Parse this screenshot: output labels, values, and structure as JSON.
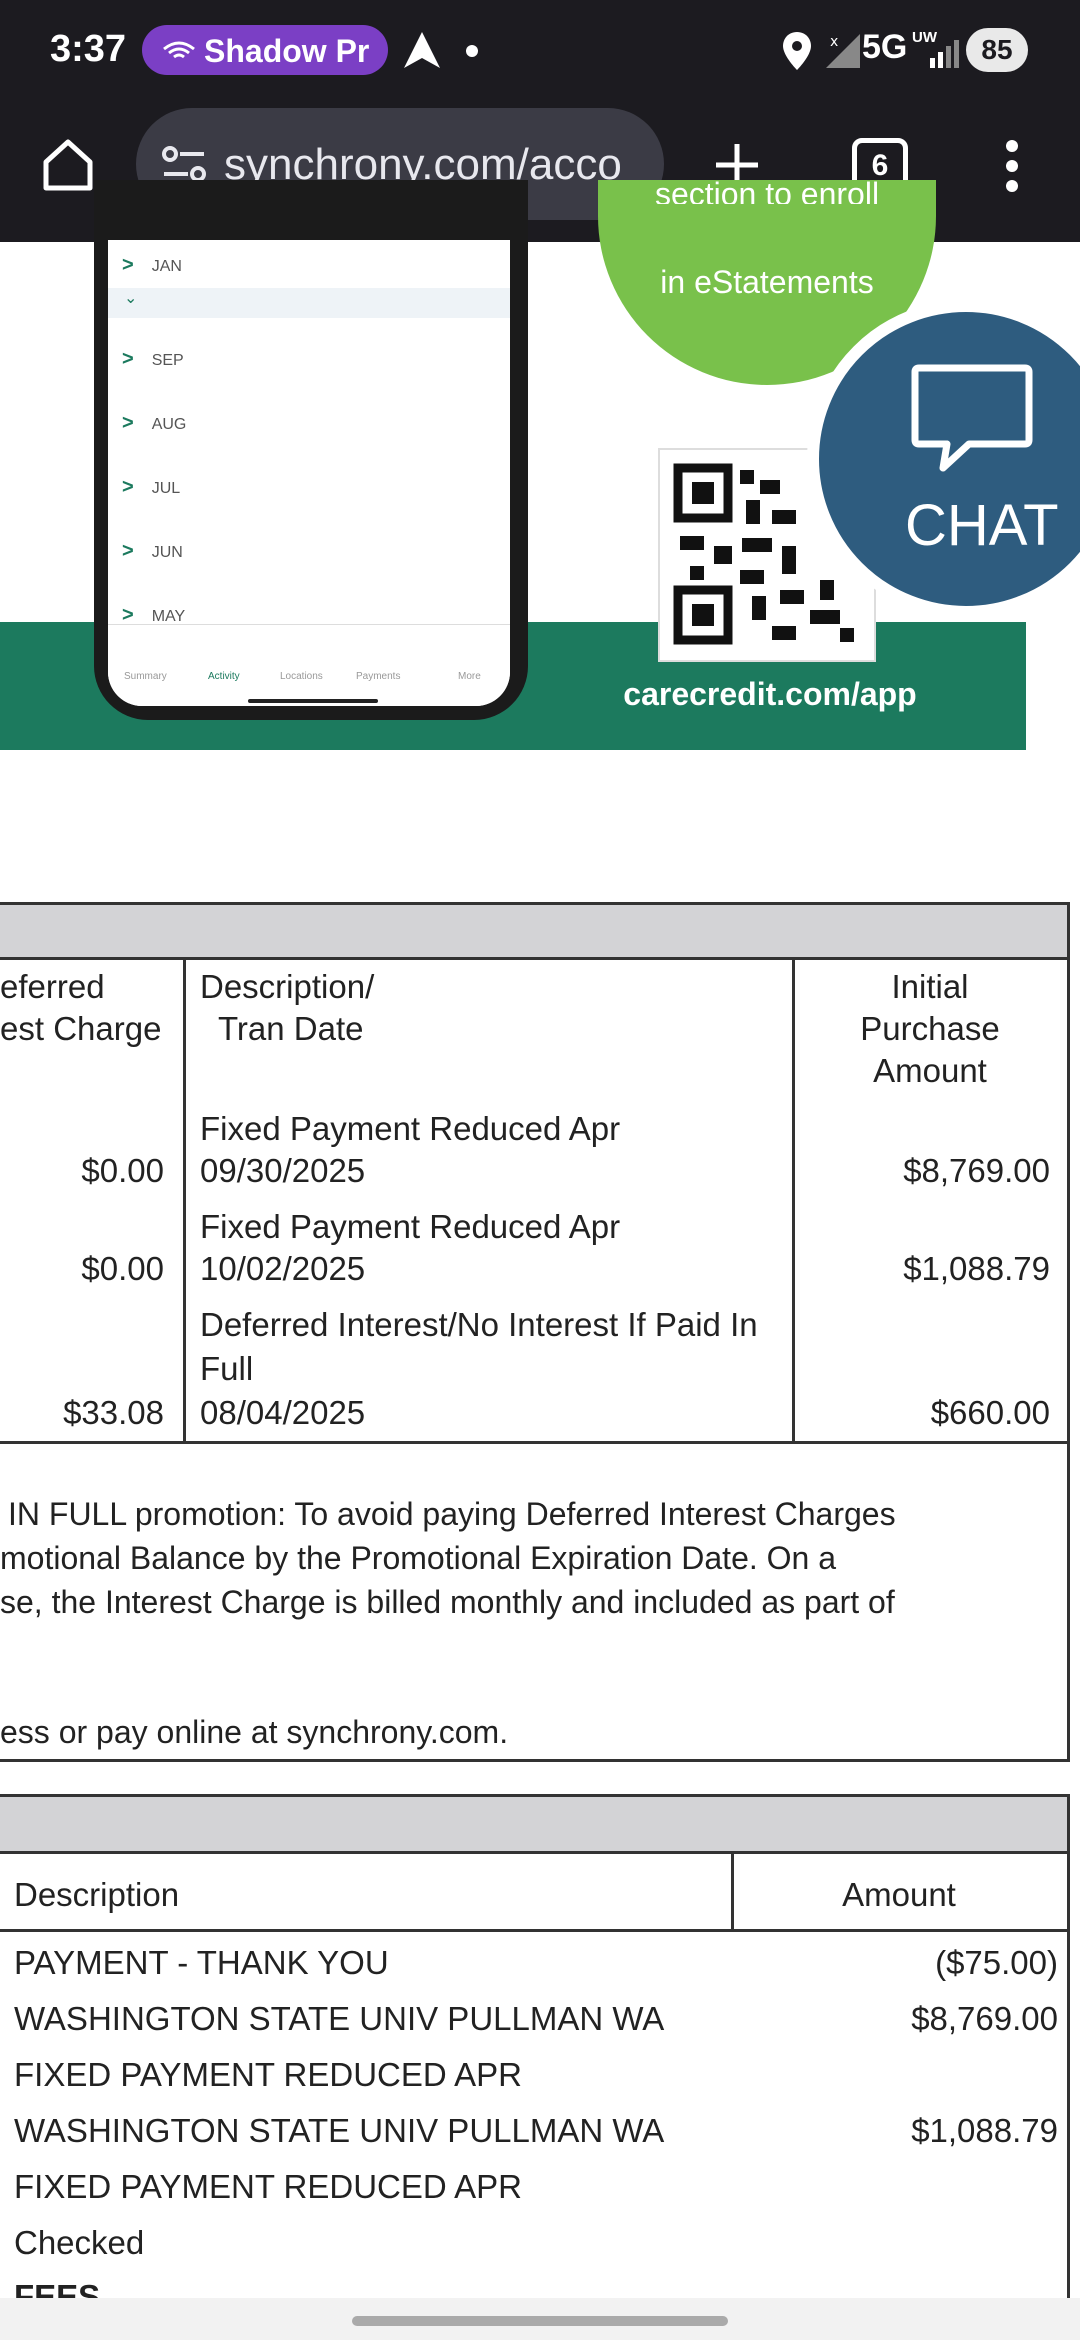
{
  "status_bar": {
    "time": "3:37",
    "notification_app": "Shadow Pr",
    "network": "5G",
    "network_sup": "UW",
    "battery": "85"
  },
  "browser": {
    "url": "synchrony.com/acco",
    "tab_count": "6"
  },
  "ad": {
    "circle_line1": "section to enroll",
    "circle_line2": "in eStatements",
    "app_url": "carecredit.com/app",
    "months": [
      "JAN",
      "SEP",
      "AUG",
      "JUL",
      "JUN",
      "MAY"
    ],
    "nav_items": [
      "Summary",
      "Activity",
      "Locations",
      "Payments",
      "More"
    ]
  },
  "chat": {
    "label": "CHAT"
  },
  "promo_table": {
    "headers": {
      "charge_line1": "eferred",
      "charge_line2": "est Charge",
      "desc_line1": "Description/",
      "desc_line2": "Tran Date",
      "amount_line1": "Initial",
      "amount_line2": "Purchase",
      "amount_line3": "Amount"
    },
    "rows": [
      {
        "charge": "$0.00",
        "desc1": "Fixed Payment Reduced Apr",
        "desc2": "09/30/2025",
        "amount": "$8,769.00"
      },
      {
        "charge": "$0.00",
        "desc1": "Fixed Payment Reduced Apr",
        "desc2": "10/02/2025",
        "amount": "$1,088.79"
      },
      {
        "charge": "$33.08",
        "desc1": "Deferred Interest/No Interest If Paid In",
        "desc1b": "Full",
        "desc2": "08/04/2025",
        "amount": "$660.00"
      }
    ],
    "note_line1": "IN FULL promotion: To avoid paying Deferred Interest Charges",
    "note_line2": "motional Balance by the Promotional Expiration Date.  On a",
    "note_line3": "se, the Interest Charge is billed monthly and included as part of",
    "note_line4": "ess or pay online at synchrony.com."
  },
  "transactions": {
    "headers": {
      "description": "Description",
      "amount": "Amount"
    },
    "rows": [
      {
        "description": "PAYMENT - THANK YOU",
        "amount": "($75.00)"
      },
      {
        "description": "WASHINGTON STATE UNIV PULLMAN  WA",
        "amount": "$8,769.00"
      },
      {
        "description": "FIXED PAYMENT REDUCED APR",
        "amount": ""
      },
      {
        "description": "WASHINGTON STATE UNIV PULLMAN  WA",
        "amount": "$1,088.79"
      },
      {
        "description": "FIXED PAYMENT REDUCED APR",
        "amount": ""
      },
      {
        "description": "Checked",
        "amount": ""
      },
      {
        "description": "FEES",
        "amount": ""
      }
    ]
  }
}
